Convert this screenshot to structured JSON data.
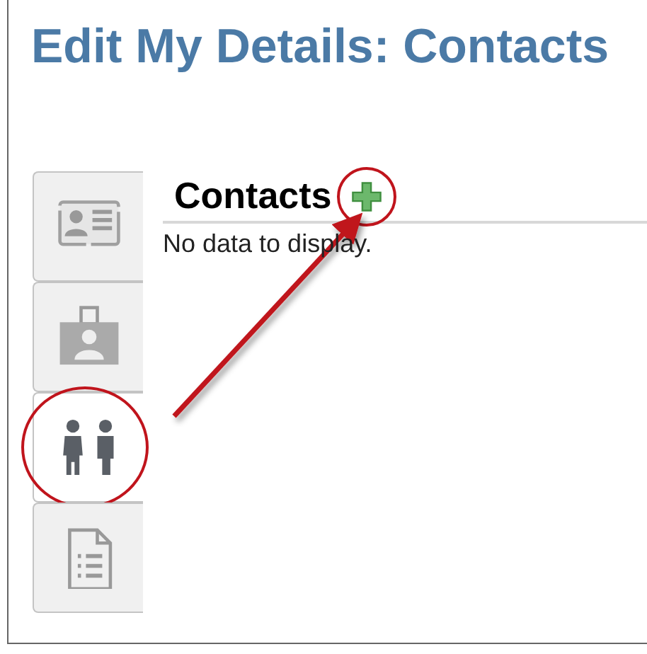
{
  "page": {
    "title": "Edit My Details: Contacts"
  },
  "tabs": [
    {
      "selected": false,
      "highlighted": false
    },
    {
      "selected": false,
      "highlighted": false
    },
    {
      "selected": true,
      "highlighted": true
    },
    {
      "selected": false,
      "highlighted": false
    }
  ],
  "section": {
    "title": "Contacts",
    "add_button_highlighted": true,
    "empty_message": "No data to display."
  }
}
